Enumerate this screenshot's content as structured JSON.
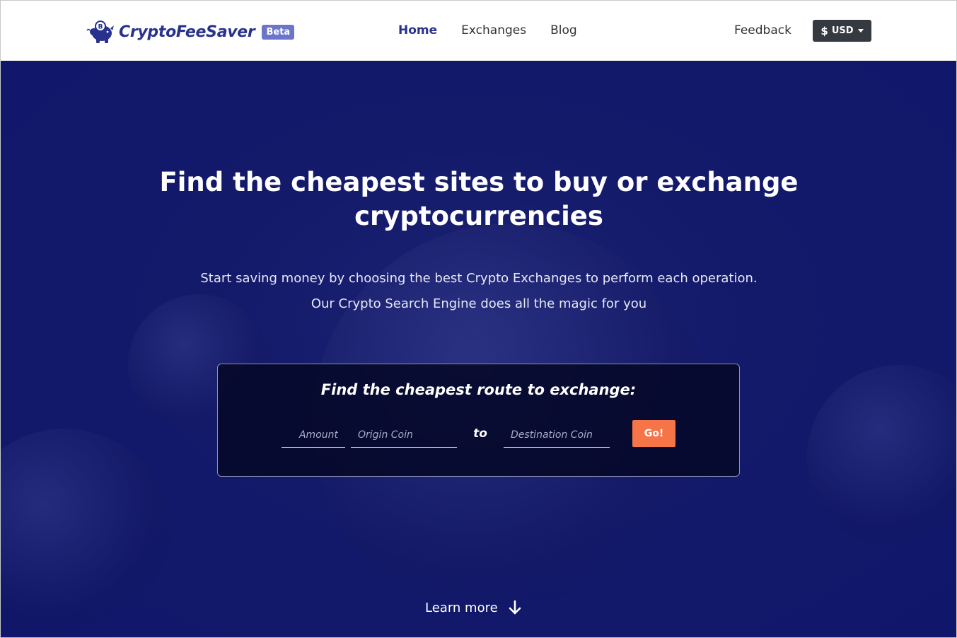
{
  "brand": {
    "name": "CryptoFeeSaver",
    "badge": "Beta",
    "logo_icon": "piggy-bank-bitcoin-icon"
  },
  "nav": {
    "items": [
      {
        "label": "Home",
        "active": true
      },
      {
        "label": "Exchanges",
        "active": false
      },
      {
        "label": "Blog",
        "active": false
      }
    ],
    "feedback": "Feedback",
    "currency": {
      "symbol": "$",
      "label": "USD"
    }
  },
  "hero": {
    "title_line1": "Find the cheapest sites to buy or exchange",
    "title_line2": "cryptocurrencies",
    "subtitle_line1": "Start saving money by choosing the best Crypto Exchanges to perform each operation.",
    "subtitle_line2": "Our Crypto Search Engine does all the magic for you"
  },
  "search": {
    "title": "Find the cheapest route to exchange:",
    "amount_placeholder": "Amount",
    "origin_placeholder": "Origin Coin",
    "to_label": "to",
    "destination_placeholder": "Destination Coin",
    "go_label": "Go!"
  },
  "learn_more": {
    "label": "Learn more",
    "icon": "arrow-down-icon"
  },
  "colors": {
    "brand": "#28328d",
    "hero_bg": "#141a6a",
    "go_button": "#f57448",
    "currency_button": "#343a40"
  }
}
